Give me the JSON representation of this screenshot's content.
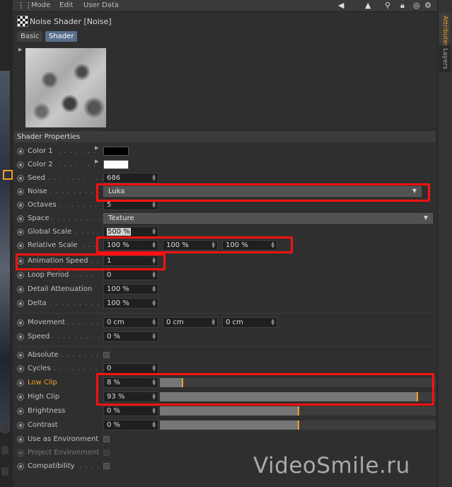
{
  "menu": {
    "items": [
      "Mode",
      "Edit",
      "User Data"
    ]
  },
  "right_tabs": {
    "attributes": "Attributes",
    "layers": "Layers"
  },
  "header": {
    "title": "Noise Shader [Noise]",
    "tab_basic": "Basic",
    "tab_shader": "Shader"
  },
  "section_title": "Shader Properties",
  "fields": {
    "color1": {
      "label": "Color 1",
      "color": "#000000"
    },
    "color2": {
      "label": "Color 2",
      "color": "#ffffff"
    },
    "seed": {
      "label": "Seed",
      "value": "686"
    },
    "noise": {
      "label": "Noise",
      "value": "Luka"
    },
    "octaves": {
      "label": "Octaves",
      "value": "5"
    },
    "space": {
      "label": "Space",
      "value": "Texture"
    },
    "global_scale": {
      "label": "Global Scale",
      "value": "500 %"
    },
    "relative_scale": {
      "label": "Relative Scale",
      "values": [
        "100 %",
        "100 %",
        "100 %"
      ]
    },
    "animation_speed": {
      "label": "Animation Speed",
      "value": "1"
    },
    "loop_period": {
      "label": "Loop Period",
      "value": "0"
    },
    "detail_attenuation": {
      "label": "Detail Attenuation",
      "value": "100 %"
    },
    "delta": {
      "label": "Delta",
      "value": "100 %"
    },
    "movement": {
      "label": "Movement",
      "values": [
        "0 cm",
        "0 cm",
        "0 cm"
      ]
    },
    "speed": {
      "label": "Speed",
      "value": "0 %"
    },
    "absolute": {
      "label": "Absolute",
      "checked": false
    },
    "cycles": {
      "label": "Cycles",
      "value": "0"
    },
    "low_clip": {
      "label": "Low Clip",
      "value": "8 %",
      "fraction": 0.08
    },
    "high_clip": {
      "label": "High Clip",
      "value": "93 %",
      "fraction": 0.93
    },
    "brightness": {
      "label": "Brightness",
      "value": "0 %",
      "fraction": 0.5
    },
    "contrast": {
      "label": "Contrast",
      "value": "0 %",
      "fraction": 0.5
    },
    "use_as_environment": {
      "label": "Use as Environment",
      "checked": false
    },
    "project_environment": {
      "label": "Project Environment",
      "checked": false
    },
    "compatibility": {
      "label": "Compatibility",
      "checked": false
    }
  },
  "colors": {
    "accent": "#f29f24",
    "highlight": "#ff1111",
    "low_clip_label": "#f2a12a"
  },
  "watermark": "VideoSmile.ru"
}
